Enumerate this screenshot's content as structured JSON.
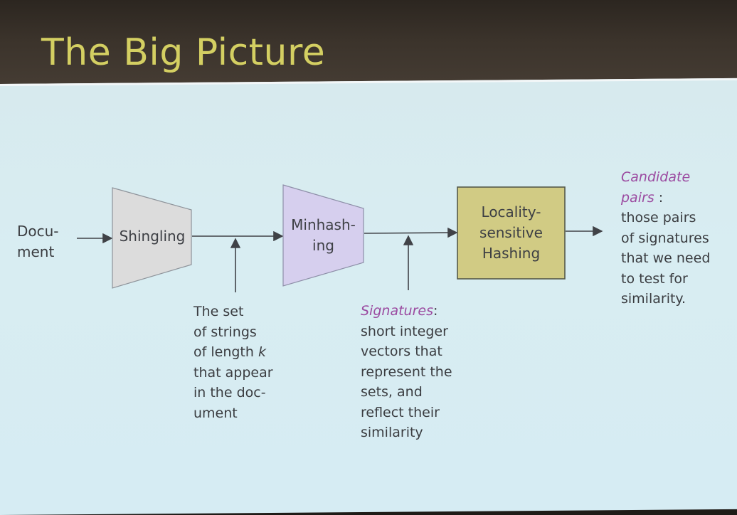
{
  "slide": {
    "title": "The Big Picture"
  },
  "colors": {
    "title": "#d4cf62",
    "shingling_shape": "#dcdcdc",
    "minhashing_shape": "#d6cfee",
    "lsh_box": "#d1cb84",
    "emphasis_text": "#9b4aa0"
  },
  "input": {
    "label": "Docu-\nment"
  },
  "stages": [
    {
      "label": "Shingling"
    },
    {
      "label": "Minhash-\ning"
    },
    {
      "label": "Locality-\nsensitive\nHashing"
    }
  ],
  "annotations": {
    "shingles": "The set\nof strings\nof length k\nthat appear\nin the doc-\nument",
    "signatures_term": "Signatures",
    "signatures_desc": ":\nshort integer\nvectors that\nrepresent the\nsets, and\nreflect their\nsimilarity",
    "candidates_term": "Candidate\npairs",
    "candidates_desc": " :\nthose pairs\nof signatures\nthat we need\nto test for\nsimilarity."
  }
}
